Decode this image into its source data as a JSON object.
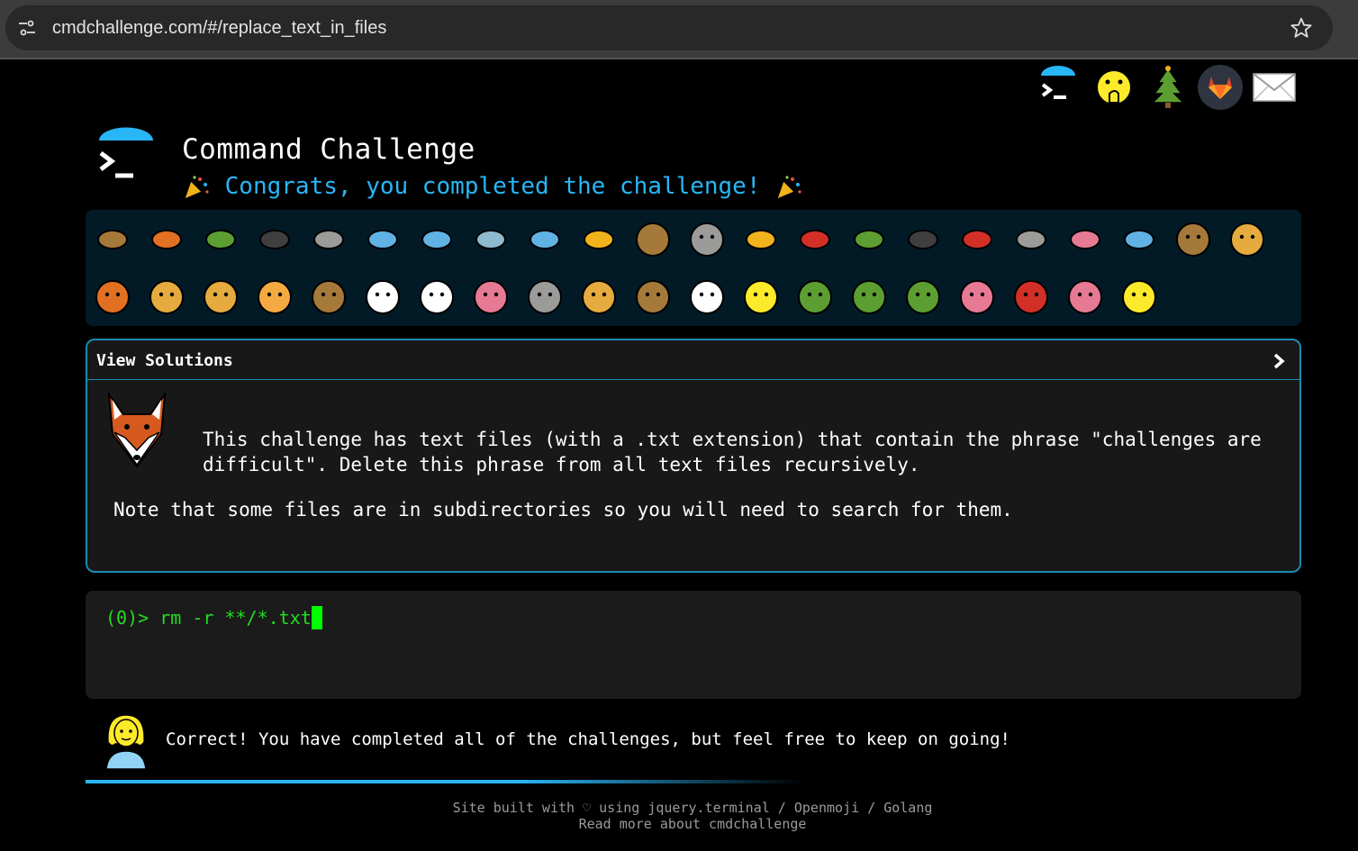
{
  "browser": {
    "url": "cmdchallenge.com/#/replace_text_in_files",
    "icons": [
      "tune-icon",
      "bookmark-star-icon"
    ]
  },
  "top_icons": [
    "terminal-logo-icon",
    "hand-over-mouth-face-icon",
    "tree-icon",
    "gitlab-icon",
    "envelope-icon"
  ],
  "header": {
    "title": "Command Challenge",
    "congrats": "Congrats, you completed the challenge!"
  },
  "badges": [
    "snail",
    "butterfly",
    "caterpillar",
    "ant",
    "spider-web",
    "whale",
    "dolphin",
    "shark",
    "fish",
    "tropical-fish",
    "blowfish",
    "wolf",
    "bee",
    "ladybug",
    "cricket",
    "spider",
    "scorpion",
    "fly",
    "worm",
    "microbe",
    "monkey",
    "dog",
    "fox",
    "cat",
    "lion",
    "tiger",
    "horse",
    "unicorn",
    "cow",
    "pig",
    "mouse",
    "hamster",
    "bear",
    "panda",
    "hatching-chick",
    "peacock",
    "frog",
    "dragon",
    "cherry-blossom",
    "rose",
    "hibiscus",
    "sunflower"
  ],
  "solutions": {
    "heading": "View Solutions",
    "description": "This challenge has text files (with a .txt extension) that contain the phrase \"challenges are difficult\". Delete this phrase from all text files recursively.",
    "note": "Note that some files are in subdirectories so you will need to search for them."
  },
  "terminal": {
    "prompt": "(0)> ",
    "command": "rm -r **/*.txt"
  },
  "result": {
    "message": "Correct! You have completed all of the challenges, but feel free to keep on going!"
  },
  "footer": {
    "line1": "Site built with ♡ using jquery.terminal / Openmoji / Golang",
    "line2": "Read more about cmdchallenge"
  },
  "colors": {
    "accent": "#29b6f6",
    "terminal_green": "#22dd22",
    "panel_border": "#1a8cb3"
  }
}
